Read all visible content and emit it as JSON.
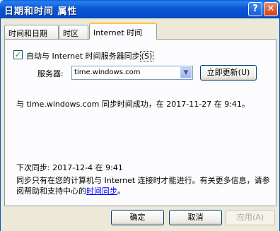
{
  "window": {
    "title": "日期和时间 属性",
    "help_label": "?",
    "close_label": "✕"
  },
  "tabs": [
    {
      "label": "时间和日期"
    },
    {
      "label": "时区"
    },
    {
      "label": "Internet 时间"
    }
  ],
  "sync": {
    "auto_checkbox_label": "自动与 Internet 时间服务器同步",
    "auto_checkbox_hotkey": "(S)",
    "checked": true,
    "server_label": "服务器:",
    "server_value": "time.windows.com",
    "update_button": "立即更新",
    "update_hotkey": "(U)",
    "status_text": "与 time.windows.com 同步时间成功，在 2017-11-27 在 9:41。",
    "next_sync_text": "下次同步: 2017-12-4 在 9:41",
    "info_text": "同步只有在您的计算机与 Internet 连接时才能进行。有关更多信息，请参阅帮助和支持中心的",
    "info_link": "时间同步",
    "info_end": "。"
  },
  "buttons": {
    "ok": "确定",
    "cancel": "取消",
    "apply": "应用",
    "apply_hotkey": "(A)"
  },
  "icons": {
    "check": "checkmark-icon",
    "arrow": "chevron-down-icon"
  }
}
